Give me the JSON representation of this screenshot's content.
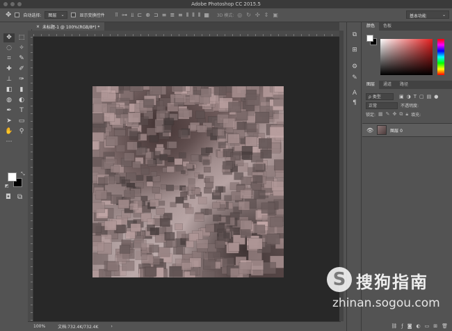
{
  "window": {
    "title": "Adobe Photoshop CC 2015.5"
  },
  "options_bar": {
    "auto_select_label": "自动选择:",
    "auto_select_value": "图层",
    "show_transform_label": "显示变换控件",
    "mode_3d_label": "3D 模式:",
    "workspace_value": "基本功能"
  },
  "document": {
    "tab_label": "未标题-1 @ 100%(RGB/8*) *",
    "close_glyph": "×"
  },
  "status_bar": {
    "zoom": "100%",
    "doc_info": "文档:732.4K/732.4K"
  },
  "color_panel": {
    "tabs": [
      "颜色",
      "色板"
    ],
    "fg_color": "#ffffff",
    "bg_color": "#000000"
  },
  "layers_panel": {
    "tabs": [
      "图层",
      "通道",
      "路径"
    ],
    "filter_label": "ρ 类型",
    "blend_mode": "正常",
    "opacity_label": "不透明度:",
    "lock_label": "锁定:",
    "fill_label": "填充:",
    "layers": [
      {
        "name": "图层 0",
        "visible": true
      }
    ]
  },
  "watermark": {
    "brand_cn": "搜狗指南",
    "url": "zhinan.sogou.com",
    "logo_letter": "S"
  }
}
